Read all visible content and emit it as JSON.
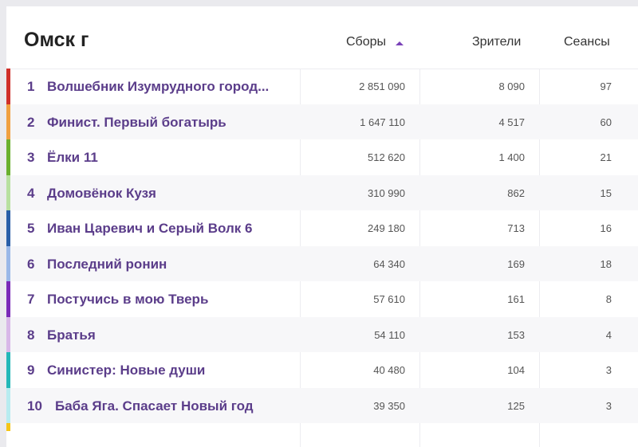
{
  "header": {
    "city": "Омск г",
    "columns": {
      "sbory": "Сборы",
      "zriteli": "Зрители",
      "seansy": "Сеансы"
    }
  },
  "colors": {
    "accent": "#7a42b8",
    "title_text": "#5b3d8a",
    "stripes": [
      "#d0302a",
      "#f0a040",
      "#6ab02e",
      "#b8e0a0",
      "#2a5fa8",
      "#9ab8e8",
      "#7a2ab8",
      "#d8b8e8",
      "#24b8b8",
      "#b8ecf0"
    ],
    "last_stripe": "#f5c518"
  },
  "rows": [
    {
      "rank": "1",
      "title": "Волшебник Изумрудного город...",
      "sbory": "2 851 090",
      "zriteli": "8 090",
      "seansy": "97"
    },
    {
      "rank": "2",
      "title": "Финист. Первый богатырь",
      "sbory": "1 647 110",
      "zriteli": "4 517",
      "seansy": "60"
    },
    {
      "rank": "3",
      "title": "Ёлки 11",
      "sbory": "512 620",
      "zriteli": "1 400",
      "seansy": "21"
    },
    {
      "rank": "4",
      "title": "Домовёнок Кузя",
      "sbory": "310 990",
      "zriteli": "862",
      "seansy": "15"
    },
    {
      "rank": "5",
      "title": "Иван Царевич и Серый Волк 6",
      "sbory": "249 180",
      "zriteli": "713",
      "seansy": "16"
    },
    {
      "rank": "6",
      "title": "Последний ронин",
      "sbory": "64 340",
      "zriteli": "169",
      "seansy": "18"
    },
    {
      "rank": "7",
      "title": "Постучись в мою Тверь",
      "sbory": "57 610",
      "zriteli": "161",
      "seansy": "8"
    },
    {
      "rank": "8",
      "title": "Братья",
      "sbory": "54 110",
      "zriteli": "153",
      "seansy": "4"
    },
    {
      "rank": "9",
      "title": "Синистер: Новые души",
      "sbory": "40 480",
      "zriteli": "104",
      "seansy": "3"
    },
    {
      "rank": "10",
      "title": "Баба Яга. Спасает Новый год",
      "sbory": "39 350",
      "zriteli": "125",
      "seansy": "3"
    }
  ]
}
